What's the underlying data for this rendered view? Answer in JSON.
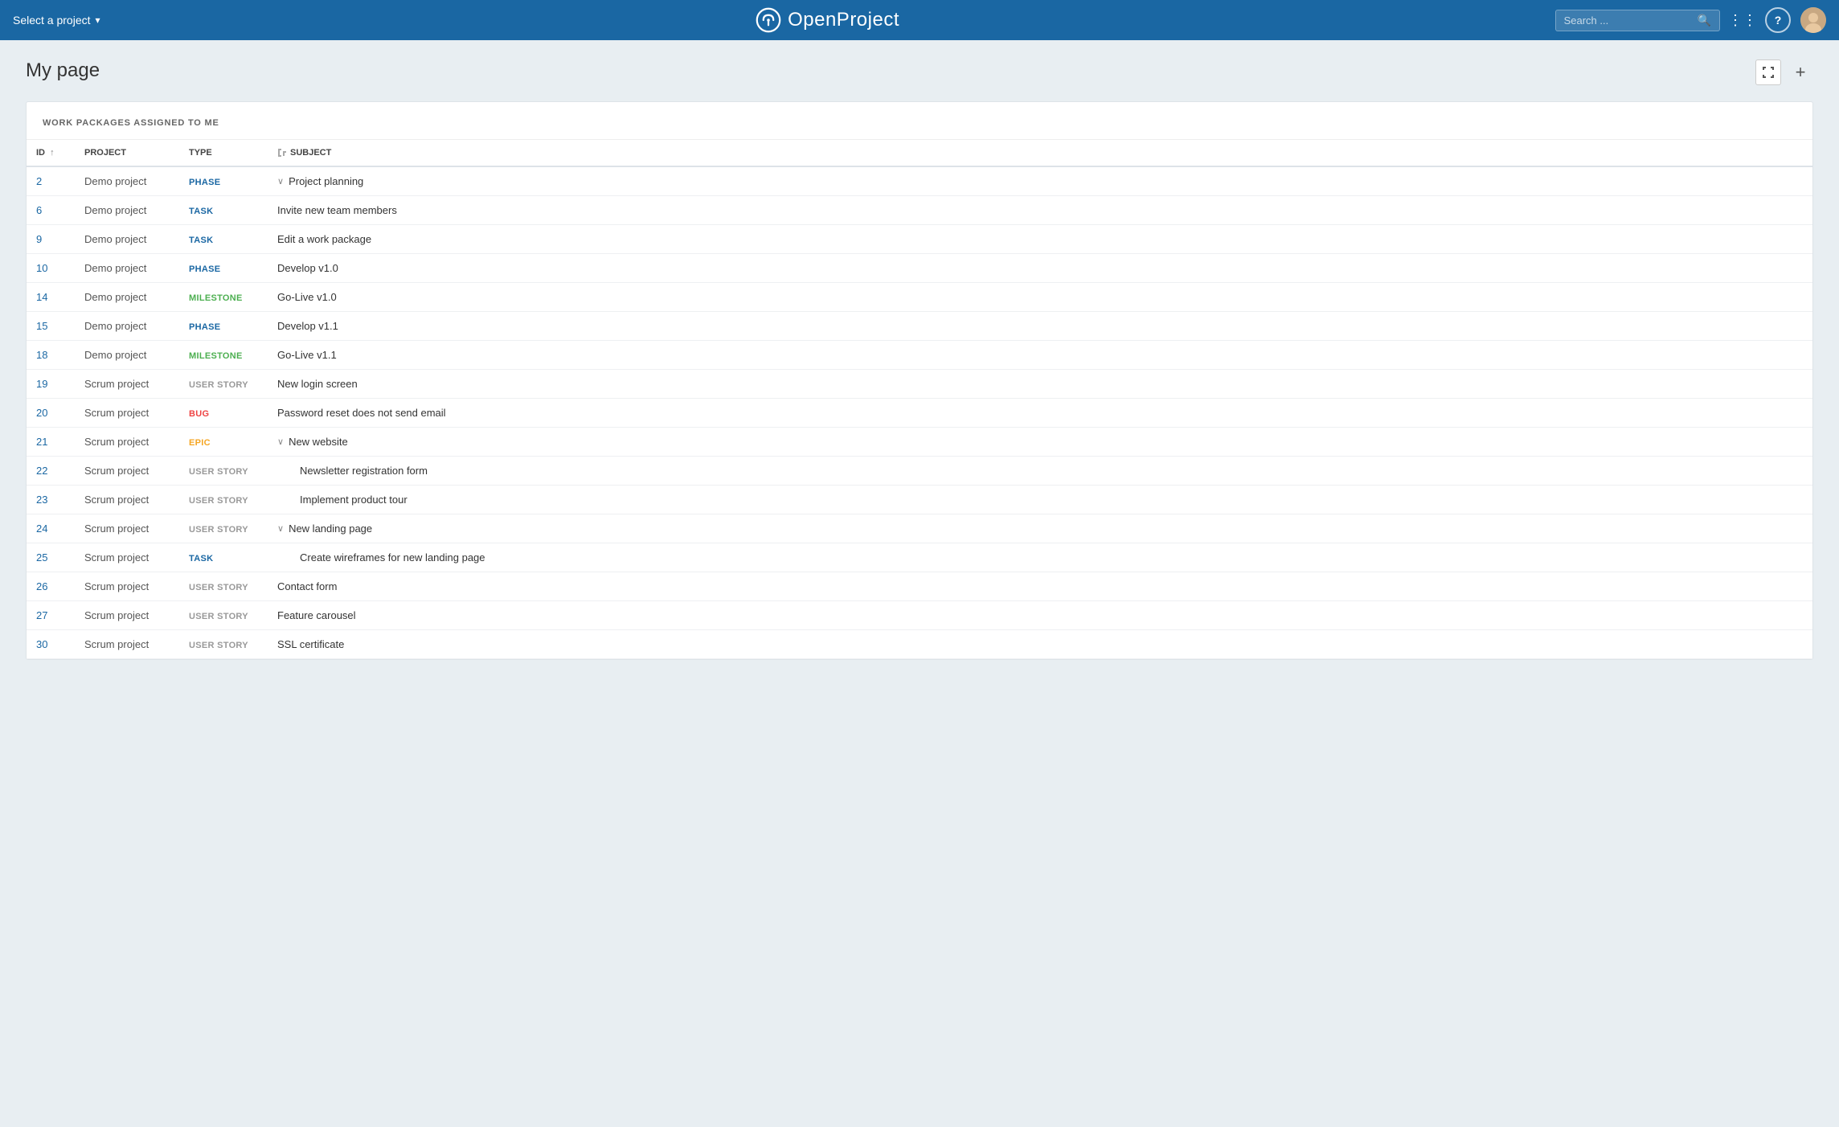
{
  "header": {
    "project_selector": "Select a project",
    "logo_text": "OpenProject",
    "search_placeholder": "Search ...",
    "modules_icon": "modules",
    "help_icon": "help",
    "user_icon": "user-avatar"
  },
  "page": {
    "title": "My page",
    "fullscreen_label": "Fullscreen",
    "add_label": "+"
  },
  "widget": {
    "title": "WORK PACKAGES ASSIGNED TO ME",
    "columns": {
      "id": "ID",
      "project": "PROJECT",
      "type": "TYPE",
      "subject": "SUBJECT"
    },
    "rows": [
      {
        "id": "2",
        "project": "Demo project",
        "type": "PHASE",
        "type_class": "type-phase",
        "subject": "Project planning",
        "indent": false,
        "has_chevron": true
      },
      {
        "id": "6",
        "project": "Demo project",
        "type": "TASK",
        "type_class": "type-task",
        "subject": "Invite new team members",
        "indent": false,
        "has_chevron": false
      },
      {
        "id": "9",
        "project": "Demo project",
        "type": "TASK",
        "type_class": "type-task",
        "subject": "Edit a work package",
        "indent": false,
        "has_chevron": false
      },
      {
        "id": "10",
        "project": "Demo project",
        "type": "PHASE",
        "type_class": "type-phase",
        "subject": "Develop v1.0",
        "indent": false,
        "has_chevron": false
      },
      {
        "id": "14",
        "project": "Demo project",
        "type": "MILESTONE",
        "type_class": "type-milestone",
        "subject": "Go-Live v1.0",
        "indent": false,
        "has_chevron": false
      },
      {
        "id": "15",
        "project": "Demo project",
        "type": "PHASE",
        "type_class": "type-phase",
        "subject": "Develop v1.1",
        "indent": false,
        "has_chevron": false
      },
      {
        "id": "18",
        "project": "Demo project",
        "type": "MILESTONE",
        "type_class": "type-milestone",
        "subject": "Go-Live v1.1",
        "indent": false,
        "has_chevron": false
      },
      {
        "id": "19",
        "project": "Scrum project",
        "type": "USER STORY",
        "type_class": "type-user-story",
        "subject": "New login screen",
        "indent": false,
        "has_chevron": false
      },
      {
        "id": "20",
        "project": "Scrum project",
        "type": "BUG",
        "type_class": "type-bug",
        "subject": "Password reset does not send email",
        "indent": false,
        "has_chevron": false
      },
      {
        "id": "21",
        "project": "Scrum project",
        "type": "EPIC",
        "type_class": "type-epic",
        "subject": "New website",
        "indent": false,
        "has_chevron": true
      },
      {
        "id": "22",
        "project": "Scrum project",
        "type": "USER STORY",
        "type_class": "type-user-story",
        "subject": "Newsletter registration form",
        "indent": true,
        "has_chevron": false
      },
      {
        "id": "23",
        "project": "Scrum project",
        "type": "USER STORY",
        "type_class": "type-user-story",
        "subject": "Implement product tour",
        "indent": true,
        "has_chevron": false
      },
      {
        "id": "24",
        "project": "Scrum project",
        "type": "USER STORY",
        "type_class": "type-user-story",
        "subject": "New landing page",
        "indent": false,
        "has_chevron": true
      },
      {
        "id": "25",
        "project": "Scrum project",
        "type": "TASK",
        "type_class": "type-task",
        "subject": "Create wireframes for new landing page",
        "indent": true,
        "has_chevron": false
      },
      {
        "id": "26",
        "project": "Scrum project",
        "type": "USER STORY",
        "type_class": "type-user-story",
        "subject": "Contact form",
        "indent": false,
        "has_chevron": false
      },
      {
        "id": "27",
        "project": "Scrum project",
        "type": "USER STORY",
        "type_class": "type-user-story",
        "subject": "Feature carousel",
        "indent": false,
        "has_chevron": false
      },
      {
        "id": "30",
        "project": "Scrum project",
        "type": "USER STORY",
        "type_class": "type-user-story",
        "subject": "SSL certificate",
        "indent": false,
        "has_chevron": false
      }
    ]
  }
}
